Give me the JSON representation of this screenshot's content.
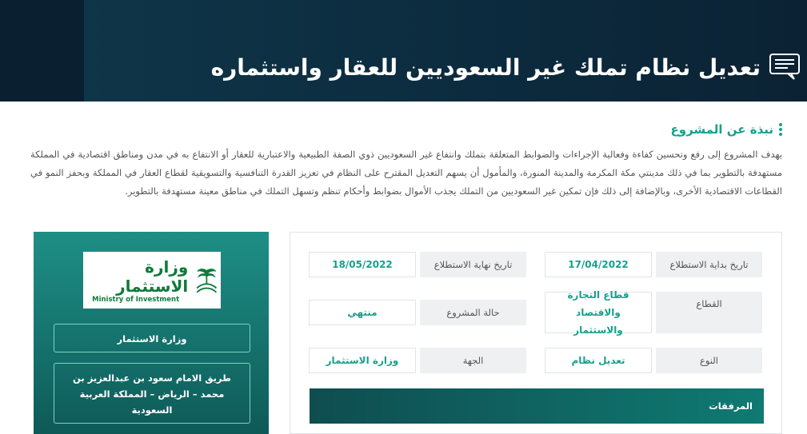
{
  "header": {
    "title": "تعديل نظام تملك غير السعوديين للعقار واستثماره",
    "icon": "chat-icon"
  },
  "about": {
    "heading": "نبذة عن المشروع",
    "paragraph": "يهدف المشروع إلى رفع وتحسين كفاءة وفعالية الإجراءات والضوابط المتعلقة بتملك وانتفاع غير السعوديين ذوي الصفة الطبيعية والاعتبارية للعقار أو الانتفاع به في مدن ومناطق اقتصادية في المملكة مستهدفة بالتطوير بما في ذلك مدينتي مكة المكرمة والمدينة المنورة، والمأمول أن يسهم التعديل المقترح على النظام في تعزيز  القدرة التنافسية والتسويقية لقطاع العقار في المملكة وبحفز النمو في القطاعات الاقتصادية الأخرى، وبالإضافة إلى ذلك فإن تمكين  غير السعوديين من التملك  يجذب الأموال بضوابط وأحكام تنظم وتسهل التملك في مناطق معينة  مستهدفة بالتطوير."
  },
  "org": {
    "logo_ar": "وزارة الاستثمار",
    "logo_en": "Ministry of Investment",
    "name": "وزارة الاستثمار",
    "address": "طريق الامام سعود بن عبدالعزيز بن محمد – الرياض – المملكة العربية السعودية"
  },
  "details": {
    "start_label": "تاريخ بداية الاستطلاع",
    "start_value": "17/04/2022",
    "end_label": "تاريخ نهاية الاستطلاع",
    "end_value": "18/05/2022",
    "sector_label": "القطاع",
    "sector_value": "قطاع التجارة والاقتصاد والاستثمار",
    "status_label": "حالة المشروع",
    "status_value": "منتهي",
    "type_label": "النوع",
    "type_value": "تعديل نظام",
    "entity_label": "الجهة",
    "entity_value": "وزارة الاستثمار",
    "attachments_label": "المرفقات"
  },
  "colors": {
    "accent": "#17a08c",
    "header_bg": "#0b2234",
    "card_gradient_start": "#1e8f85",
    "card_gradient_end": "#0e5a58"
  }
}
